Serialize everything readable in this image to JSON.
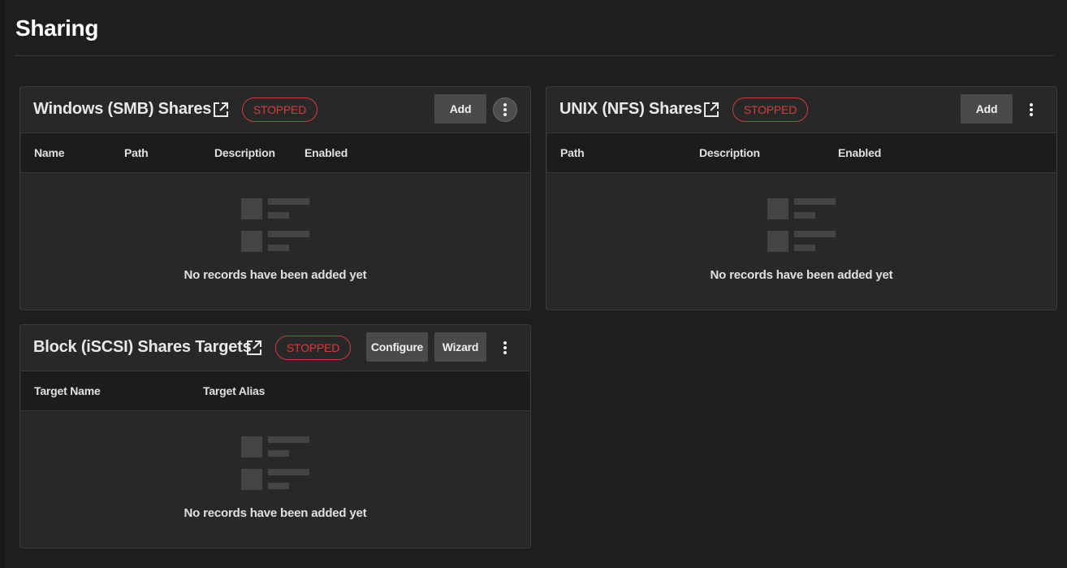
{
  "page": {
    "title": "Sharing"
  },
  "smb": {
    "title": "Windows (SMB) Shares",
    "status": "STOPPED",
    "add_label": "Add",
    "columns": [
      "Name",
      "Path",
      "Description",
      "Enabled"
    ],
    "empty_text": "No records have been added yet"
  },
  "nfs": {
    "title": "UNIX (NFS) Shares",
    "status": "STOPPED",
    "add_label": "Add",
    "columns": [
      "Path",
      "Description",
      "Enabled"
    ],
    "empty_text": "No records have been added yet"
  },
  "iscsi": {
    "title": "Block (iSCSI) Shares Targets",
    "status": "STOPPED",
    "configure_label": "Configure",
    "wizard_label": "Wizard",
    "columns": [
      "Target Name",
      "Target Alias"
    ],
    "empty_text": "No records have been added yet"
  },
  "colors": {
    "background": "#1e1e1e",
    "card": "#282828",
    "status_stopped": "#d93a3a",
    "button": "#4a4a4a"
  },
  "icons": {
    "external_link": "open-in-new-icon",
    "more": "more-vertical-icon",
    "empty": "no-records-icon"
  }
}
